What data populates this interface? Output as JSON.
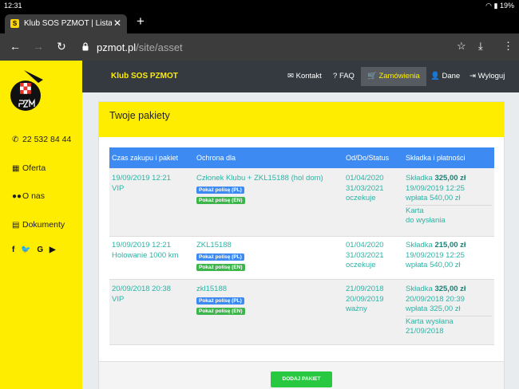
{
  "statusbar": {
    "time": "12:31",
    "battery": "19%"
  },
  "browser": {
    "tab_title": "Klub SOS PZMOT | Lista",
    "tab_favicon": "S",
    "new_tab": "+",
    "url_host": "pzmot.pl",
    "url_path": "/site/asset"
  },
  "sidebar": {
    "phone": "22 532 84 44",
    "items": [
      "Oferta",
      "O nas",
      "Dokumenty"
    ],
    "social": [
      "f",
      "G"
    ]
  },
  "topnav": {
    "brand": "Klub SOS PZMOT",
    "items": [
      "Kontakt",
      "FAQ",
      "Zamówienia",
      "Dane",
      "Wyloguj"
    ]
  },
  "card": {
    "title": "Twoje pakiety",
    "headers": [
      "Czas zakupu i pakiet",
      "Ochrona dla",
      "Od/Do/Status",
      "Składka i płatności"
    ],
    "badges": {
      "pl": "Pokaż polisę (PL)",
      "en": "Pokaż polisę (EN)"
    },
    "rows": [
      {
        "date": "19/09/2019 12:21",
        "package": "VIP",
        "protected": "Członek Klubu + ZKL15188 (hol dom)",
        "from": "01/04/2020",
        "to": "31/03/2021",
        "status": "oczekuje",
        "fee_label": "Składka",
        "fee": "325,00 zł",
        "paid_date": "19/09/2019 12:25",
        "payment": "wpłata 540,00 zł",
        "card_line1": "Karta",
        "card_line2": "do wysłania"
      },
      {
        "date": "19/09/2019 12:21",
        "package": "Holowanie 1000 km",
        "protected": "ZKL15188",
        "from": "01/04/2020",
        "to": "31/03/2021",
        "status": "oczekuje",
        "fee_label": "Składka",
        "fee": "215,00 zł",
        "paid_date": "19/09/2019 12:25",
        "payment": "wpłata 540,00 zł"
      },
      {
        "date": "20/09/2018 20:38",
        "package": "VIP",
        "protected": "zkl15188",
        "from": "21/09/2018",
        "to": "20/09/2019",
        "status": "ważny",
        "fee_label": "Składka",
        "fee": "325,00 zł",
        "paid_date": "20/09/2018 20:39",
        "payment": "wpłata 325,00 zł",
        "card_line1": "Karta wysłana",
        "card_line2": "21/09/2018"
      }
    ],
    "add_button": "DODAJ PAKIET"
  },
  "colors": {
    "accent_yellow": "#ffed00",
    "table_header": "#3d8bf2",
    "text_teal": "#2bb3a5",
    "button_green": "#28c940"
  }
}
